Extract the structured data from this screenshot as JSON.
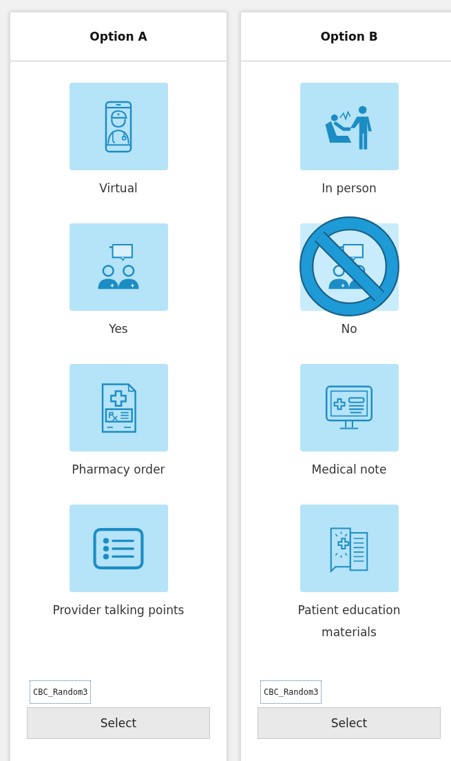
{
  "options": [
    {
      "title": "Option A",
      "attributes": [
        {
          "label": "Virtual",
          "kind": "phone-doctor"
        },
        {
          "label": "Yes",
          "kind": "consult"
        },
        {
          "label": "Pharmacy order",
          "kind": "prescription"
        },
        {
          "label": "Provider talking points",
          "kind": "list"
        }
      ],
      "code": "CBC_Random3",
      "button": "Select"
    },
    {
      "title": "Option B",
      "attributes": [
        {
          "label": "In person",
          "kind": "patient-doctor"
        },
        {
          "label": "No",
          "kind": "consult-prohibited"
        },
        {
          "label": "Medical note",
          "kind": "monitor-note"
        },
        {
          "label": "Patient education materials",
          "kind": "leaflet"
        }
      ],
      "code": "CBC_Random3",
      "button": "Select"
    }
  ]
}
